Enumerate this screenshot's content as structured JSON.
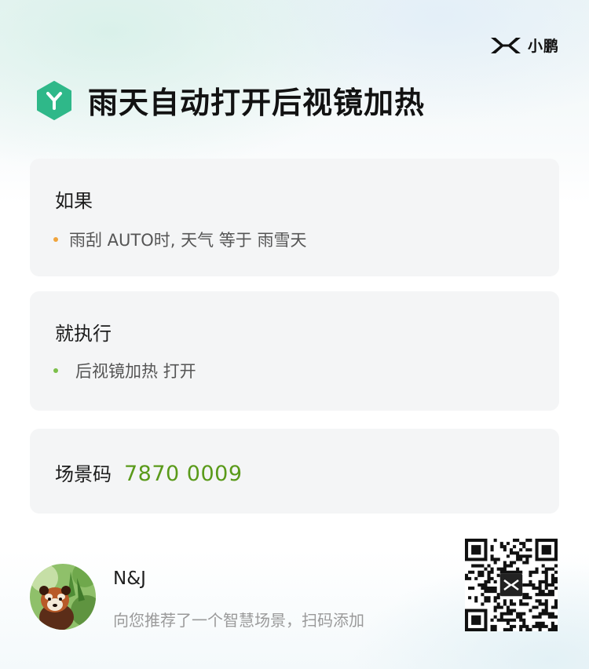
{
  "brand": {
    "name": "小鹏",
    "logo": "xpeng-logo"
  },
  "scene": {
    "title": "雨天自动打开后视镜加热",
    "icon": "hexagon-y-icon",
    "icon_color": "#2fb889"
  },
  "condition": {
    "heading": "如果",
    "items": [
      {
        "text": "雨刮 AUTO时, 天气 等于 雨雪天",
        "dot_color": "#f0a43c"
      }
    ]
  },
  "action": {
    "heading": "就执行",
    "items": [
      {
        "text": "后视镜加热 打开",
        "dot_color": "#7cbf4a"
      }
    ]
  },
  "scene_code": {
    "label": "场景码",
    "value": "7870 0009",
    "color": "#5a9a1a"
  },
  "sharer": {
    "name": "N&J",
    "avatar": "red-panda-avatar",
    "message": "向您推荐了一个智慧场景，扫码添加"
  },
  "qr": {
    "icon": "qr-code",
    "center_logo": "xpeng-logo"
  }
}
